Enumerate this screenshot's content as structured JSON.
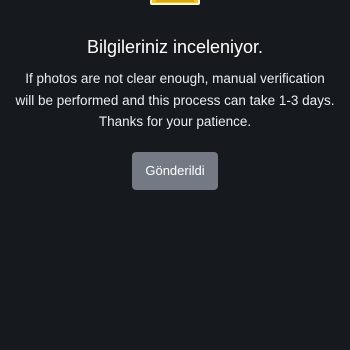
{
  "review": {
    "title": "Bilgileriniz inceleniyor.",
    "message_lines": [
      "If photos are not clear enough, manual verification",
      "will be performed and this process can take 1-3 days.",
      "Thanks for your patience."
    ],
    "button_label": "Gönderildi"
  },
  "colors": {
    "background": "#16191d",
    "button": "#737a84",
    "illustration": "#f3c623"
  }
}
